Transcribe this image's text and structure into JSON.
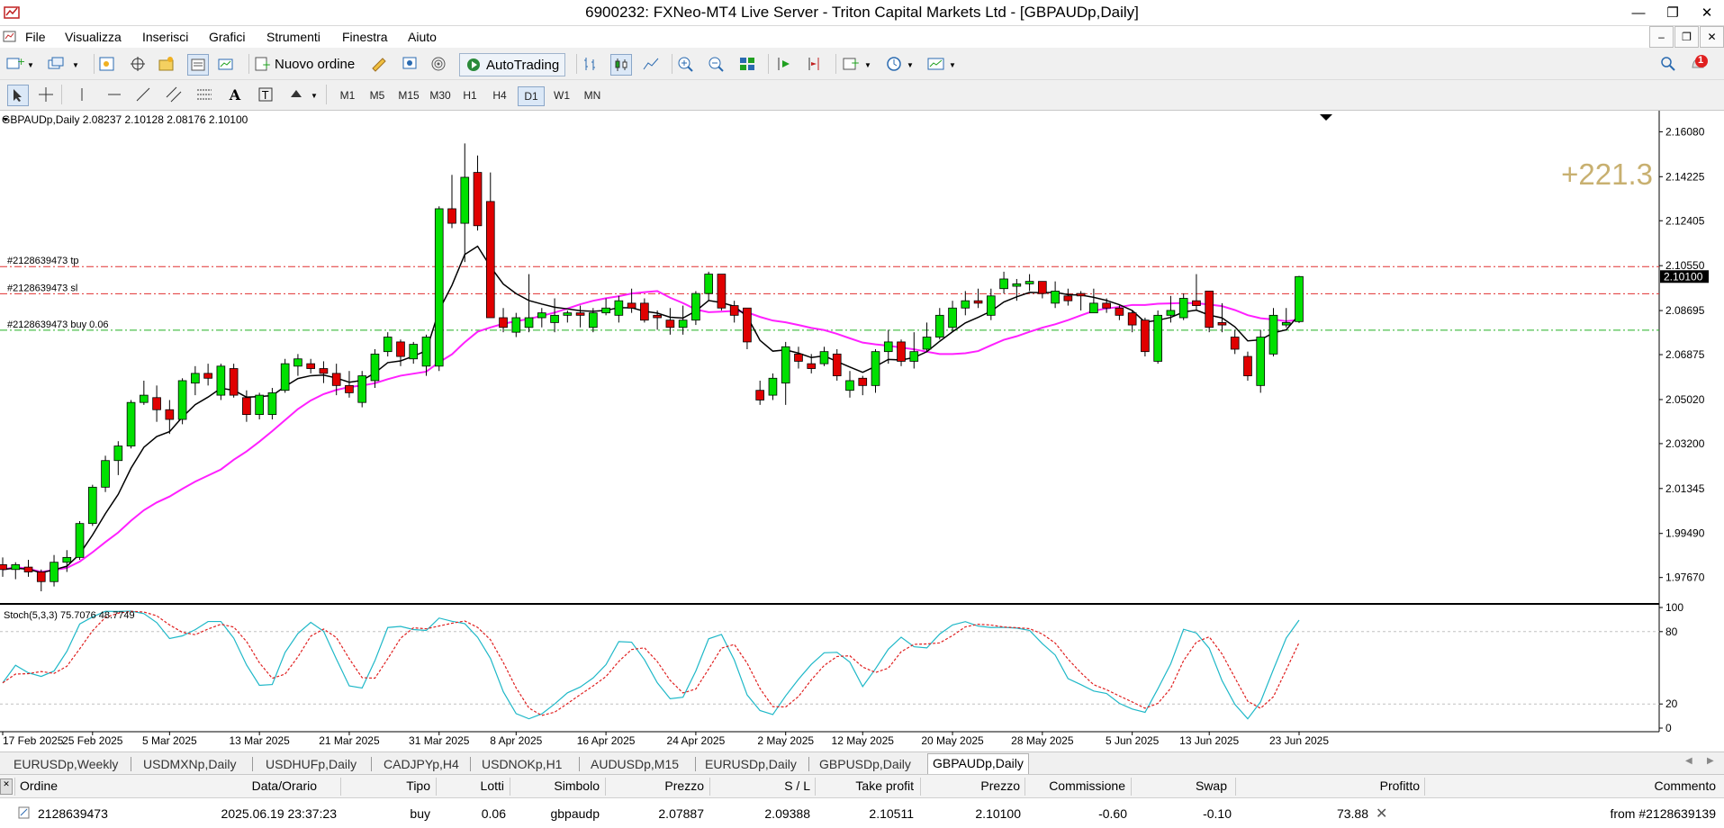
{
  "window": {
    "title": "6900232: FXNeo-MT4 Live Server - Triton Capital Markets Ltd - [GBPAUDp,Daily]"
  },
  "menu": [
    "File",
    "Visualizza",
    "Inserisci",
    "Grafici",
    "Strumenti",
    "Finestra",
    "Aiuto"
  ],
  "toolbar": {
    "new_order_label": "Nuovo ordine",
    "autotrading_label": "AutoTrading",
    "alert_badge": "1"
  },
  "timeframes": [
    "M1",
    "M5",
    "M15",
    "M30",
    "H1",
    "H4",
    "D1",
    "W1",
    "MN"
  ],
  "active_timeframe": "D1",
  "chart": {
    "header": "GBPAUDp,Daily  2.08237 2.10128 2.08176 2.10100",
    "profit_overlay": "+221.3",
    "current_price_label": "2.10100",
    "order_lines": [
      {
        "label": "#2128639473 tp",
        "price": 2.10511,
        "color": "#e03030",
        "style": "dashdot"
      },
      {
        "label": "#2128639473 sl",
        "price": 2.09388,
        "color": "#e03030",
        "style": "dashdot"
      },
      {
        "label": "#2128639473 buy 0.06",
        "price": 2.07887,
        "color": "#22b022",
        "style": "dashdot"
      }
    ],
    "colors": {
      "bull": "#00e000",
      "bear": "#e00000",
      "wick": "#000000",
      "ma_fast": "#000000",
      "ma_slow": "#ff20ff",
      "stoch_main": "#1fb8c8",
      "stoch_signal": "#e02020",
      "grid": "#c0c0c0"
    }
  },
  "chart_data": {
    "type": "candlestick",
    "title": "GBPAUDp,Daily",
    "ylim": [
      1.9658,
      2.1695
    ],
    "y_ticks": [
      "2.16080",
      "2.14225",
      "2.12405",
      "2.10550",
      "2.08695",
      "2.06875",
      "2.05020",
      "2.03200",
      "2.01345",
      "1.99490",
      "1.97670"
    ],
    "x_tick_labels": [
      "17 Feb 2025",
      "25 Feb 2025",
      "5 Mar 2025",
      "13 Mar 2025",
      "21 Mar 2025",
      "31 Mar 2025",
      "8 Apr 2025",
      "16 Apr 2025",
      "24 Apr 2025",
      "2 May 2025",
      "12 May 2025",
      "20 May 2025",
      "28 May 2025",
      "5 Jun 2025",
      "13 Jun 2025",
      "23 Jun 2025"
    ],
    "ohlc": [
      [
        1.982,
        1.985,
        1.977,
        1.98
      ],
      [
        1.98,
        1.983,
        1.976,
        1.982
      ],
      [
        1.981,
        1.984,
        1.977,
        1.979
      ],
      [
        1.979,
        1.98,
        1.971,
        1.975
      ],
      [
        1.975,
        1.986,
        1.973,
        1.983
      ],
      [
        1.983,
        1.988,
        1.979,
        1.985
      ],
      [
        1.985,
        2.0,
        1.984,
        1.999
      ],
      [
        1.999,
        2.015,
        1.998,
        2.014
      ],
      [
        2.014,
        2.027,
        2.012,
        2.025
      ],
      [
        2.025,
        2.033,
        2.019,
        2.031
      ],
      [
        2.031,
        2.05,
        2.03,
        2.049
      ],
      [
        2.049,
        2.058,
        2.048,
        2.052
      ],
      [
        2.051,
        2.056,
        2.041,
        2.046
      ],
      [
        2.046,
        2.05,
        2.036,
        2.042
      ],
      [
        2.042,
        2.059,
        2.04,
        2.058
      ],
      [
        2.057,
        2.064,
        2.052,
        2.061
      ],
      [
        2.061,
        2.065,
        2.056,
        2.059
      ],
      [
        2.052,
        2.065,
        2.05,
        2.064
      ],
      [
        2.063,
        2.065,
        2.051,
        2.052
      ],
      [
        2.051,
        2.054,
        2.041,
        2.044
      ],
      [
        2.044,
        2.053,
        2.042,
        2.052
      ],
      [
        2.044,
        2.055,
        2.042,
        2.053
      ],
      [
        2.054,
        2.067,
        2.053,
        2.065
      ],
      [
        2.064,
        2.069,
        2.06,
        2.067
      ],
      [
        2.065,
        2.067,
        2.061,
        2.063
      ],
      [
        2.063,
        2.066,
        2.057,
        2.061
      ],
      [
        2.061,
        2.065,
        2.052,
        2.056
      ],
      [
        2.056,
        2.062,
        2.051,
        2.053
      ],
      [
        2.049,
        2.062,
        2.047,
        2.06
      ],
      [
        2.058,
        2.071,
        2.055,
        2.069
      ],
      [
        2.07,
        2.078,
        2.068,
        2.076
      ],
      [
        2.074,
        2.075,
        2.064,
        2.068
      ],
      [
        2.067,
        2.074,
        2.065,
        2.073
      ],
      [
        2.064,
        2.077,
        2.06,
        2.076
      ],
      [
        2.064,
        2.13,
        2.062,
        2.129
      ],
      [
        2.129,
        2.143,
        2.121,
        2.123
      ],
      [
        2.123,
        2.156,
        2.107,
        2.142
      ],
      [
        2.144,
        2.151,
        2.12,
        2.122
      ],
      [
        2.132,
        2.144,
        2.086,
        2.084
      ],
      [
        2.084,
        2.088,
        2.078,
        2.08
      ],
      [
        2.078,
        2.086,
        2.076,
        2.084
      ],
      [
        2.08,
        2.102,
        2.078,
        2.084
      ],
      [
        2.084,
        2.088,
        2.08,
        2.086
      ],
      [
        2.082,
        2.092,
        2.078,
        2.085
      ],
      [
        2.085,
        2.087,
        2.082,
        2.086
      ],
      [
        2.086,
        2.089,
        2.08,
        2.085
      ],
      [
        2.08,
        2.088,
        2.078,
        2.086
      ],
      [
        2.086,
        2.092,
        2.085,
        2.088
      ],
      [
        2.085,
        2.093,
        2.082,
        2.091
      ],
      [
        2.09,
        2.096,
        2.086,
        2.088
      ],
      [
        2.09,
        2.092,
        2.082,
        2.083
      ],
      [
        2.085,
        2.087,
        2.079,
        2.084
      ],
      [
        2.083,
        2.088,
        2.077,
        2.08
      ],
      [
        2.08,
        2.089,
        2.077,
        2.083
      ],
      [
        2.083,
        2.095,
        2.081,
        2.094
      ],
      [
        2.094,
        2.103,
        2.091,
        2.102
      ],
      [
        2.102,
        2.101,
        2.087,
        2.088
      ],
      [
        2.089,
        2.091,
        2.082,
        2.085
      ],
      [
        2.088,
        2.088,
        2.071,
        2.074
      ],
      [
        2.054,
        2.058,
        2.048,
        2.05
      ],
      [
        2.052,
        2.061,
        2.05,
        2.059
      ],
      [
        2.057,
        2.074,
        2.048,
        2.072
      ],
      [
        2.069,
        2.072,
        2.063,
        2.066
      ],
      [
        2.065,
        2.069,
        2.061,
        2.063
      ],
      [
        2.065,
        2.072,
        2.064,
        2.07
      ],
      [
        2.069,
        2.071,
        2.058,
        2.06
      ],
      [
        2.054,
        2.062,
        2.051,
        2.058
      ],
      [
        2.059,
        2.06,
        2.052,
        2.056
      ],
      [
        2.056,
        2.071,
        2.053,
        2.07
      ],
      [
        2.07,
        2.079,
        2.065,
        2.074
      ],
      [
        2.074,
        2.075,
        2.064,
        2.066
      ],
      [
        2.066,
        2.078,
        2.063,
        2.07
      ],
      [
        2.071,
        2.082,
        2.07,
        2.076
      ],
      [
        2.076,
        2.088,
        2.075,
        2.085
      ],
      [
        2.08,
        2.091,
        2.078,
        2.088
      ],
      [
        2.088,
        2.095,
        2.085,
        2.091
      ],
      [
        2.091,
        2.096,
        2.088,
        2.09
      ],
      [
        2.085,
        2.096,
        2.083,
        2.093
      ],
      [
        2.096,
        2.103,
        2.094,
        2.1
      ],
      [
        2.097,
        2.1,
        2.091,
        2.098
      ],
      [
        2.098,
        2.102,
        2.095,
        2.099
      ],
      [
        2.099,
        2.099,
        2.092,
        2.094
      ],
      [
        2.09,
        2.099,
        2.088,
        2.095
      ],
      [
        2.093,
        2.096,
        2.089,
        2.091
      ],
      [
        2.094,
        2.095,
        2.087,
        2.093
      ],
      [
        2.086,
        2.096,
        2.086,
        2.09
      ],
      [
        2.09,
        2.092,
        2.086,
        2.088
      ],
      [
        2.088,
        2.089,
        2.083,
        2.085
      ],
      [
        2.086,
        2.087,
        2.078,
        2.081
      ],
      [
        2.083,
        2.084,
        2.068,
        2.07
      ],
      [
        2.066,
        2.087,
        2.065,
        2.085
      ],
      [
        2.085,
        2.093,
        2.082,
        2.087
      ],
      [
        2.084,
        2.094,
        2.083,
        2.092
      ],
      [
        2.091,
        2.102,
        2.087,
        2.089
      ],
      [
        2.095,
        2.095,
        2.078,
        2.08
      ],
      [
        2.082,
        2.09,
        2.078,
        2.081
      ],
      [
        2.076,
        2.079,
        2.069,
        2.071
      ],
      [
        2.068,
        2.07,
        2.058,
        2.06
      ],
      [
        2.056,
        2.079,
        2.053,
        2.076
      ],
      [
        2.069,
        2.088,
        2.068,
        2.085
      ],
      [
        2.081,
        2.088,
        2.08,
        2.082
      ],
      [
        2.0824,
        2.1013,
        2.0818,
        2.101
      ]
    ],
    "stoch_levels": [
      80,
      20
    ],
    "stoch_header": "Stoch(5,3,3) 75.7076 48.7749",
    "stoch_ylim": [
      0,
      100
    ],
    "stoch_y_ticks": [
      "100",
      "80",
      "20",
      "0"
    ]
  },
  "tabs": [
    "EURUSDp,Weekly",
    "USDMXNp,Daily",
    "USDHUFp,Daily",
    "CADJPYp,H4",
    "USDNOKp,H1",
    "AUDUSDp,M15",
    "EURUSDp,Daily",
    "GBPUSDp,Daily",
    "GBPAUDp,Daily"
  ],
  "active_tab": "GBPAUDp,Daily",
  "terminal": {
    "columns": [
      "Ordine",
      "Data/Orario",
      "Tipo",
      "Lotti",
      "Simbolo",
      "Prezzo",
      "S / L",
      "Take profit",
      "Prezzo",
      "Commissione",
      "Swap",
      "Profitto",
      "Commento"
    ],
    "rows": [
      [
        "2128639473",
        "2025.06.19 23:37:23",
        "buy",
        "0.06",
        "gbpaudp",
        "2.07887",
        "2.09388",
        "2.10511",
        "2.10100",
        "-0.60",
        "-0.10",
        "73.88",
        "from #2128639139"
      ]
    ]
  }
}
